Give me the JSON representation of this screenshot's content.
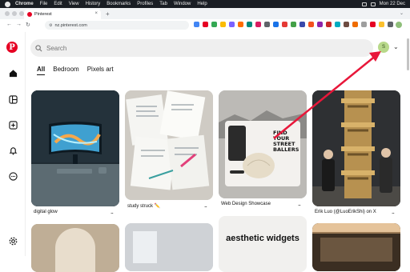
{
  "menubar": {
    "app": "Chrome",
    "items": [
      "File",
      "Edit",
      "View",
      "History",
      "Bookmarks",
      "Profiles",
      "Tab",
      "Window",
      "Help"
    ],
    "clock": "Mon 22 Dec  "
  },
  "browser": {
    "tab_title": "Pinterest",
    "url": "nz.pinterest.com",
    "extension_colors": [
      "#4285f4",
      "#e60023",
      "#34a853",
      "#fbbc04",
      "#7b61ff",
      "#ff6d00",
      "#00897b",
      "#d81b60",
      "#5f6368",
      "#1a73e8",
      "#e53935",
      "#43a047",
      "#3949ab",
      "#f4511e",
      "#8e24aa",
      "#c62828",
      "#00acc1",
      "#6d4c41",
      "#ef6c00",
      "#9e9e9e",
      "#e60023",
      "#fbc02d",
      "#5f6368"
    ]
  },
  "pinterest": {
    "logo": "P",
    "search_placeholder": "Search",
    "avatar_letter": "S",
    "boards": [
      "All",
      "Bedroom",
      "Pixels art"
    ],
    "rail_icons": [
      "home-icon",
      "boards-icon",
      "create-icon",
      "notifications-icon",
      "messages-icon",
      "settings-icon"
    ]
  },
  "pins": [
    {
      "caption": "digital glow",
      "dots": "..."
    },
    {
      "caption": "study struck ✏️",
      "dots": "..."
    },
    {
      "caption": "Web Design Showcase",
      "dots": "..."
    },
    {
      "caption": "Erik Luo (@LuoErikShi) on X",
      "dots": "..."
    }
  ],
  "web_pin": {
    "headline": "FIND YOUR STREET BALLERS"
  },
  "aesthetic_pin": {
    "text": "aesthetic widgets"
  },
  "colors": {
    "brand": "#e60023",
    "annotation": "#e8173a"
  }
}
